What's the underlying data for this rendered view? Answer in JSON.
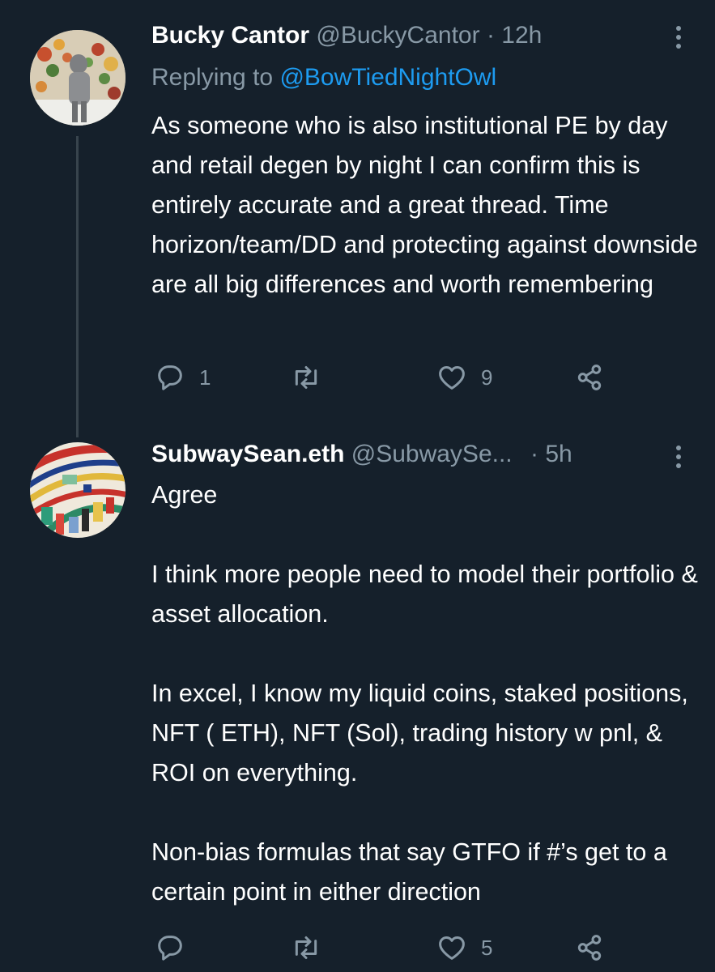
{
  "tweets": [
    {
      "display_name": "Bucky Cantor",
      "handle": "@BuckyCantor",
      "separator": "·",
      "time": "12h",
      "replying_to_prefix": "Replying to ",
      "replying_to_handle": "@BowTiedNightOwl",
      "text": "As someone who is also institutional PE by day and retail degen by night I can confirm this is entirely accurate and a great thread. Time horizon/team/DD and protecting against downside are all big differences and worth remembering",
      "reply_count": "1",
      "retweet_count": "",
      "like_count": "9"
    },
    {
      "display_name": "SubwaySean.eth",
      "handle": "@SubwaySe...",
      "separator": "·",
      "time": "5h",
      "paragraphs": [
        "Agree",
        "I think more people need to model their portfolio & asset allocation.",
        "In excel, I know my liquid coins, staked positions, NFT ( ETH), NFT (Sol), trading history w pnl, & ROI on everything.",
        "Non-bias formulas that say GTFO if #’s get to a certain point in either direction"
      ],
      "reply_count": "",
      "retweet_count": "",
      "like_count": "5"
    }
  ],
  "icons": {
    "reply": "reply-icon",
    "retweet": "retweet-icon",
    "like": "heart-icon",
    "share": "share-icon",
    "more": "more-vertical-icon"
  },
  "colors": {
    "background": "#15202b",
    "primary_text": "#ffffff",
    "secondary_text": "#8899a6",
    "link": "#1d9bf0",
    "thread_line": "#38444d"
  }
}
